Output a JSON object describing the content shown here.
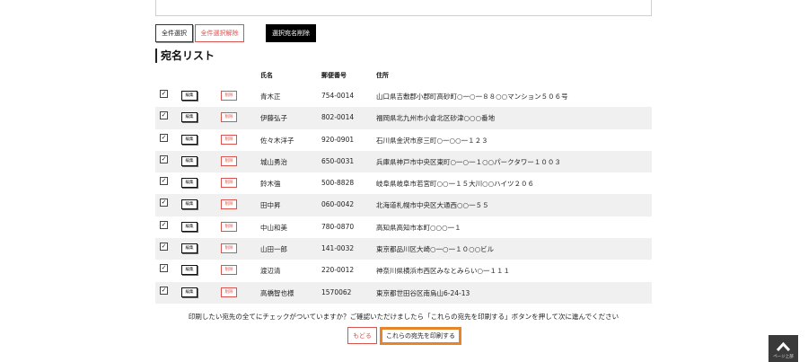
{
  "toolbar": {
    "select_all": "全件選択",
    "deselect_all": "全件選択解除",
    "delete_selected": "選択宛名削除"
  },
  "section_title": "宛名リスト",
  "table": {
    "headers": {
      "name": "氏名",
      "zip": "郵便番号",
      "address": "住所"
    },
    "edit_label": "編集",
    "delete_label": "削除",
    "rows": [
      {
        "checked": true,
        "name": "青木正",
        "zip": "754-0014",
        "address": "山口県吉敷郡小郡町高砂町○一○一８８○○マンション５０６号"
      },
      {
        "checked": true,
        "name": "伊藤弘子",
        "zip": "802-0014",
        "address": "福岡県北九州市小倉北区砂津○○○番地"
      },
      {
        "checked": true,
        "name": "佐々木洋子",
        "zip": "920-0901",
        "address": "石川県金沢市彦三町○一○○一１２３"
      },
      {
        "checked": true,
        "name": "城山勇治",
        "zip": "650-0031",
        "address": "兵庫県神戸市中央区東町○一○一１○○パークタワー１００３"
      },
      {
        "checked": true,
        "name": "鈴木強",
        "zip": "500-8828",
        "address": "岐阜県岐阜市若宮町○○一１５大川○○ハイツ２０６"
      },
      {
        "checked": true,
        "name": "田中昇",
        "zip": "060-0042",
        "address": "北海道札幌市中央区大通西○○一５５"
      },
      {
        "checked": true,
        "name": "中山和美",
        "zip": "780-0870",
        "address": "高知県高知市本町○○○一１"
      },
      {
        "checked": true,
        "name": "山田一郎",
        "zip": "141-0032",
        "address": "東京都品川区大崎○一○一１０○○ビル"
      },
      {
        "checked": true,
        "name": "渡辺清",
        "zip": "220-0012",
        "address": "神奈川県横浜市西区みなとみらい○一１１１"
      },
      {
        "checked": true,
        "name": "高橋智也様",
        "zip": "1570062",
        "address": "東京都世田谷区南烏山6-24-13"
      }
    ]
  },
  "notice": "印刷したい宛先の全てにチェックがついていますか？ご確認いただけましたら「これらの宛先を印刷する」ボタンを押して次に進んでください",
  "buttons": {
    "back": "もどる",
    "print": "これらの宛先を印刷する"
  },
  "page_top": {
    "icon": "chevron-up-icon",
    "label": "ページ上部"
  },
  "colors": {
    "accent_orange": "#e8852b",
    "danger_red": "#d9534f",
    "dark": "#000000"
  }
}
